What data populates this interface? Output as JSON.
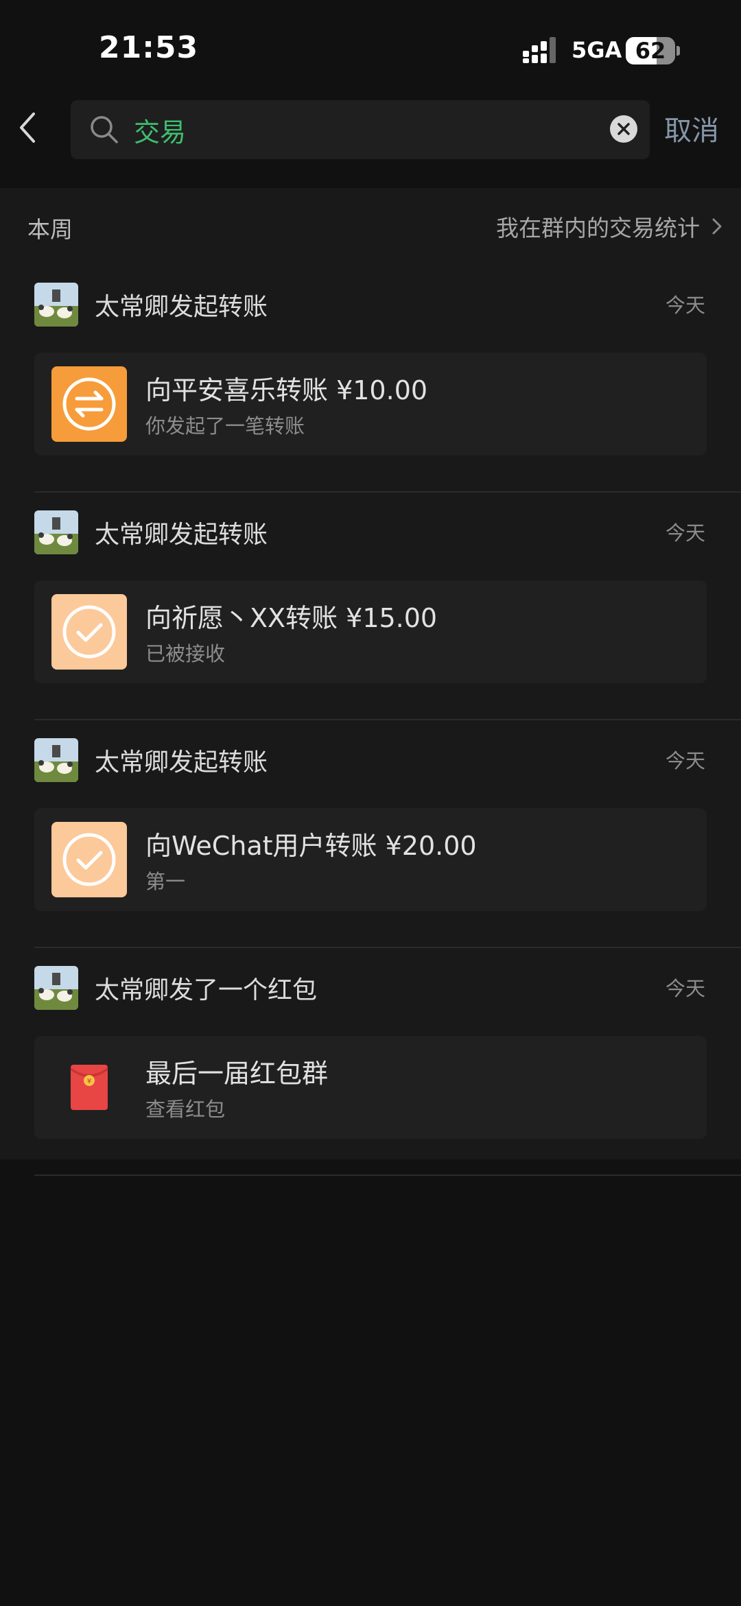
{
  "status_bar": {
    "time": "21:53",
    "network": "5GA",
    "battery": "62",
    "battery_level": 0.62
  },
  "search": {
    "query": "交易",
    "cancel_label": "取消"
  },
  "section": {
    "week_label": "本周",
    "stats_link": "我在群内的交易统计"
  },
  "entries": [
    {
      "sender": "太常卿发起转账",
      "time": "今天",
      "icon": "transfer-icon",
      "title": "向平安喜乐转账 ¥10.00",
      "subtitle": "你发起了一笔转账"
    },
    {
      "sender": "太常卿发起转账",
      "time": "今天",
      "icon": "check-circle-icon",
      "title": "向祈愿丶XX转账 ¥15.00",
      "subtitle": "已被接收"
    },
    {
      "sender": "太常卿发起转账",
      "time": "今天",
      "icon": "check-circle-icon",
      "title": "向WeChat用户转账 ¥20.00",
      "subtitle": "第一"
    },
    {
      "sender": "太常卿发了一个红包",
      "time": "今天",
      "icon": "red-envelope-icon",
      "title": "最后一届红包群",
      "subtitle": "查看红包"
    }
  ],
  "colors": {
    "accent_green": "#3fbd6f",
    "cancel_blue": "#8597aa",
    "transfer_orange": "#f79c3a",
    "accepted_peach": "#fcc99a",
    "envelope_red": "#e84545"
  }
}
